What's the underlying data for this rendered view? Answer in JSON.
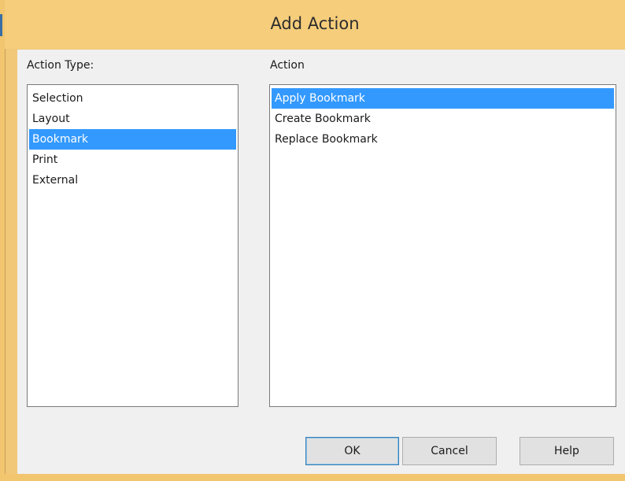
{
  "dialog": {
    "title": "Add Action"
  },
  "action_type": {
    "label": "Action Type:",
    "items": [
      "Selection",
      "Layout",
      "Bookmark",
      "Print",
      "External"
    ],
    "selected": "Bookmark"
  },
  "action": {
    "label": "Action",
    "items": [
      "Apply Bookmark",
      "Create Bookmark",
      "Replace Bookmark"
    ],
    "selected": "Apply Bookmark"
  },
  "buttons": {
    "ok": "OK",
    "cancel": "Cancel",
    "help": "Help"
  },
  "colors": {
    "title_bar": "#f5cd7b",
    "selection": "#3399ff"
  }
}
